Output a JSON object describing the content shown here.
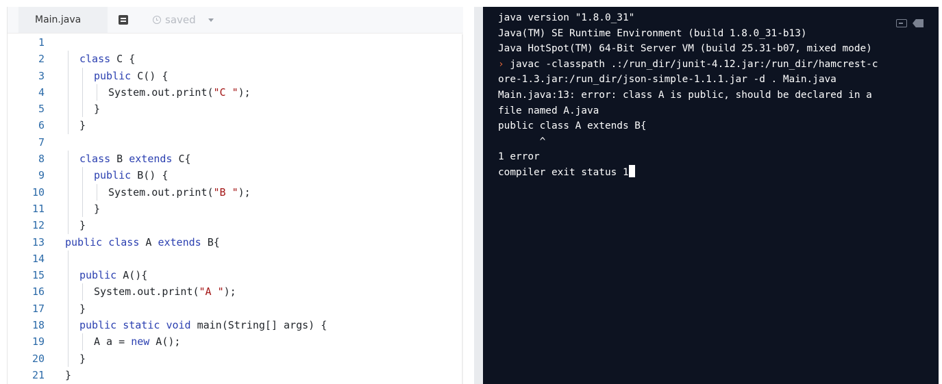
{
  "editor": {
    "tab_filename": "Main.java",
    "format_icon": "format-icon",
    "save_status": "saved",
    "code_lines": [
      {
        "n": "1",
        "indent": 0,
        "tokens": []
      },
      {
        "n": "2",
        "indent": 1,
        "tokens": [
          {
            "t": "class",
            "c": "kw"
          },
          {
            "t": " C {",
            "c": ""
          }
        ]
      },
      {
        "n": "3",
        "indent": 2,
        "tokens": [
          {
            "t": "public",
            "c": "kw"
          },
          {
            "t": " C() {",
            "c": ""
          }
        ]
      },
      {
        "n": "4",
        "indent": 3,
        "tokens": [
          {
            "t": "System.out.print(",
            "c": ""
          },
          {
            "t": "\"C \"",
            "c": "str"
          },
          {
            "t": ");",
            "c": ""
          }
        ]
      },
      {
        "n": "5",
        "indent": 2,
        "tokens": [
          {
            "t": "}",
            "c": ""
          }
        ]
      },
      {
        "n": "6",
        "indent": 1,
        "tokens": [
          {
            "t": "}",
            "c": ""
          }
        ]
      },
      {
        "n": "7",
        "indent": 0,
        "tokens": []
      },
      {
        "n": "8",
        "indent": 1,
        "tokens": [
          {
            "t": "class",
            "c": "kw"
          },
          {
            "t": " B ",
            "c": ""
          },
          {
            "t": "extends",
            "c": "kw"
          },
          {
            "t": " C{",
            "c": ""
          }
        ]
      },
      {
        "n": "9",
        "indent": 2,
        "tokens": [
          {
            "t": "public",
            "c": "kw"
          },
          {
            "t": " B() {",
            "c": ""
          }
        ]
      },
      {
        "n": "10",
        "indent": 3,
        "tokens": [
          {
            "t": "System.out.print(",
            "c": ""
          },
          {
            "t": "\"B \"",
            "c": "str"
          },
          {
            "t": ");",
            "c": ""
          }
        ]
      },
      {
        "n": "11",
        "indent": 2,
        "tokens": [
          {
            "t": "}",
            "c": ""
          }
        ]
      },
      {
        "n": "12",
        "indent": 1,
        "tokens": [
          {
            "t": "}",
            "c": ""
          }
        ]
      },
      {
        "n": "13",
        "indent": 0,
        "tokens": [
          {
            "t": "public",
            "c": "kw"
          },
          {
            "t": " ",
            "c": ""
          },
          {
            "t": "class",
            "c": "kw"
          },
          {
            "t": " A ",
            "c": ""
          },
          {
            "t": "extends",
            "c": "kw"
          },
          {
            "t": " B{",
            "c": ""
          }
        ]
      },
      {
        "n": "14",
        "indent": 1,
        "tokens": []
      },
      {
        "n": "15",
        "indent": 1,
        "tokens": [
          {
            "t": "public",
            "c": "kw"
          },
          {
            "t": " A(){",
            "c": ""
          }
        ]
      },
      {
        "n": "16",
        "indent": 2,
        "tokens": [
          {
            "t": "System.out.print(",
            "c": ""
          },
          {
            "t": "\"A \"",
            "c": "str"
          },
          {
            "t": ");",
            "c": ""
          }
        ]
      },
      {
        "n": "17",
        "indent": 1,
        "tokens": [
          {
            "t": "}",
            "c": ""
          }
        ]
      },
      {
        "n": "18",
        "indent": 1,
        "tokens": [
          {
            "t": "public",
            "c": "kw"
          },
          {
            "t": " ",
            "c": ""
          },
          {
            "t": "static",
            "c": "kw"
          },
          {
            "t": " ",
            "c": ""
          },
          {
            "t": "void",
            "c": "kw"
          },
          {
            "t": " main(String[] args) {",
            "c": ""
          }
        ]
      },
      {
        "n": "19",
        "indent": 2,
        "tokens": [
          {
            "t": "A a = ",
            "c": ""
          },
          {
            "t": "new",
            "c": "kw"
          },
          {
            "t": " A();",
            "c": ""
          }
        ]
      },
      {
        "n": "20",
        "indent": 1,
        "tokens": [
          {
            "t": "}",
            "c": ""
          }
        ]
      },
      {
        "n": "21",
        "indent": 0,
        "tokens": [
          {
            "t": "}",
            "c": ""
          }
        ]
      }
    ]
  },
  "console": {
    "wrap_icon": "wrap-icon",
    "clear_icon": "clear-icon",
    "lines": [
      "java version \"1.8.0_31\"",
      "Java(TM) SE Runtime Environment (build 1.8.0_31-b13)",
      "Java HotSpot(TM) 64-Bit Server VM (build 25.31-b07, mixed mode)",
      "javac -classpath .:/run_dir/junit-4.12.jar:/run_dir/hamcrest-c",
      "ore-1.3.jar:/run_dir/json-simple-1.1.1.jar -d . Main.java",
      "Main.java:13: error: class A is public, should be declared in a",
      "file named A.java",
      "public class A extends B{",
      "       ^",
      "1 error",
      "compiler exit status 1"
    ],
    "prompt_symbol": "›",
    "prompt_line_index": 3
  },
  "colors": {
    "keyword": "#2a3fb0",
    "string": "#a31515",
    "line_number": "#2b6aa8",
    "console_bg": "#0d1321",
    "prompt": "#e0663a"
  }
}
